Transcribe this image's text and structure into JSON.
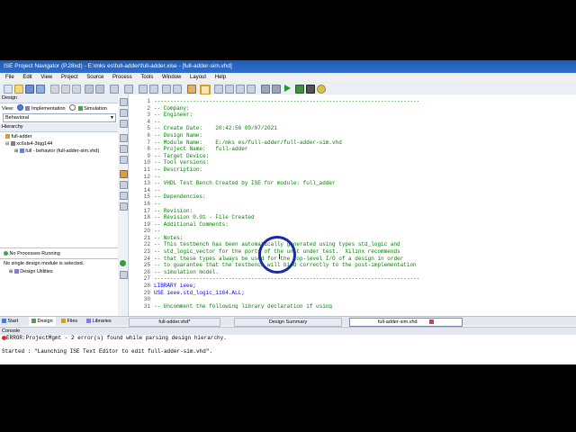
{
  "window": {
    "title": "ISE Project Navigator (P.28xd) - E:\\mks es\\full-adder\\full-adder.xise - [full-adder-sim.vhd]"
  },
  "menu": [
    "File",
    "Edit",
    "View",
    "Project",
    "Source",
    "Process",
    "Tools",
    "Window",
    "Layout",
    "Help"
  ],
  "design_panel": {
    "header": "Design",
    "view_label": "View:",
    "impl_label": "Implementation",
    "sim_label": "Simulation",
    "dropdown_value": "Behavioral",
    "hierarchy_label": "Hierarchy",
    "tree": [
      "full-adder",
      "xc6slx4-3tqg144",
      "full - behavior (full-adder-sim.vhd)"
    ],
    "processes_status": "No Processes Running",
    "process_msg": "No single design module is selected.",
    "design_utilities": "Design Utilities"
  },
  "editor": {
    "lines": [
      {
        "n": "1",
        "t": "----------------------------------------------------------------------------------",
        "c": "cmt"
      },
      {
        "n": "2",
        "t": "-- Company:",
        "c": "cmt"
      },
      {
        "n": "3",
        "t": "-- Engineer:",
        "c": "cmt"
      },
      {
        "n": "4",
        "t": "--",
        "c": "cmt"
      },
      {
        "n": "5",
        "t": "-- Create Date:    20:42:56 09/07/2021",
        "c": "cmt"
      },
      {
        "n": "6",
        "t": "-- Design Name:",
        "c": "cmt"
      },
      {
        "n": "7",
        "t": "-- Module Name:    E:/mks es/full-adder/full-adder-sim.vhd",
        "c": "cmt"
      },
      {
        "n": "8",
        "t": "-- Project Name:   full-adder",
        "c": "cmt"
      },
      {
        "n": "9",
        "t": "-- Target Device:",
        "c": "cmt"
      },
      {
        "n": "10",
        "t": "-- Tool versions:",
        "c": "cmt"
      },
      {
        "n": "11",
        "t": "-- Description:",
        "c": "cmt"
      },
      {
        "n": "12",
        "t": "--",
        "c": "cmt"
      },
      {
        "n": "13",
        "t": "-- VHDL Test Bench Created by ISE for module: full_adder",
        "c": "cmt"
      },
      {
        "n": "14",
        "t": "--",
        "c": "cmt"
      },
      {
        "n": "15",
        "t": "-- Dependencies:",
        "c": "cmt"
      },
      {
        "n": "16",
        "t": "--",
        "c": "cmt"
      },
      {
        "n": "17",
        "t": "-- Revision:",
        "c": "cmt"
      },
      {
        "n": "18",
        "t": "-- Revision 0.01 - File Created",
        "c": "cmt"
      },
      {
        "n": "19",
        "t": "-- Additional Comments:",
        "c": "cmt"
      },
      {
        "n": "20",
        "t": "--",
        "c": "cmt"
      },
      {
        "n": "21",
        "t": "-- Notes:",
        "c": "cmt"
      },
      {
        "n": "22",
        "t": "-- This testbench has been automatically generated using types std_logic and",
        "c": "cmt"
      },
      {
        "n": "23",
        "t": "-- std_logic_vector for the ports of the unit under test.  Xilinx recommends",
        "c": "cmt"
      },
      {
        "n": "24",
        "t": "-- that these types always be used for the top-level I/O of a design in order",
        "c": "cmt"
      },
      {
        "n": "25",
        "t": "-- to guarantee that the testbench will bind correctly to the post-implementation",
        "c": "cmt"
      },
      {
        "n": "26",
        "t": "-- simulation model.",
        "c": "cmt"
      },
      {
        "n": "27",
        "t": "----------------------------------------------------------------------------------",
        "c": "cmt"
      },
      {
        "n": "28",
        "t": "LIBRARY ieee;",
        "c": "kw"
      },
      {
        "n": "29",
        "t": "USE ieee.std_logic_1164.ALL;",
        "c": "kw"
      },
      {
        "n": "30",
        "t": "",
        "c": "cmt"
      },
      {
        "n": "31",
        "t": "-- Uncomment the following library declaration if using",
        "c": "cmt"
      }
    ]
  },
  "bottom_tabs": [
    "Start",
    "Design",
    "Files",
    "Libraries"
  ],
  "editor_tabs": [
    "full-adder.vhd*",
    "Design Summary",
    "full-adder-sim.vhd"
  ],
  "console": {
    "header": "Console",
    "lines": [
      "ERROR:ProjectMgmt - 2 error(s) found while parsing design hierarchy.",
      "",
      "Started : \"Launching ISE Text Editor to edit full-adder-sim.vhd\"."
    ]
  },
  "colors": {
    "titlebar": "#2f6fd0",
    "comment": "#008000",
    "keyword": "#0000ff",
    "highlight": "#1b2aa8"
  }
}
